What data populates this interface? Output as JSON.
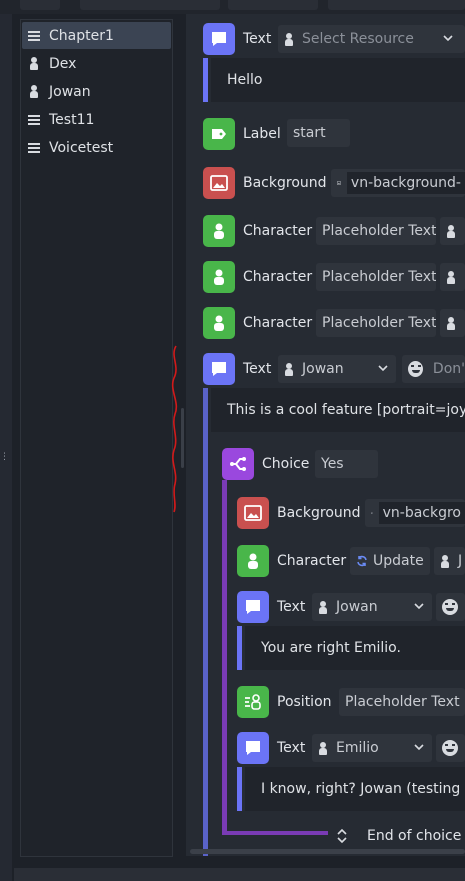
{
  "colors": {
    "text_event": "#6b74f6",
    "label_event": "#49b64a",
    "background_event": "#c9504f",
    "character_event": "#49b64a",
    "choice_event": "#9a48de",
    "selection": "#3b4453"
  },
  "tree": {
    "items": [
      {
        "label": "Chapter1",
        "icon": "list-icon"
      },
      {
        "label": "Dex",
        "icon": "person-icon"
      },
      {
        "label": "Jowan",
        "icon": "person-icon"
      },
      {
        "label": "Test11",
        "icon": "list-icon"
      },
      {
        "label": "Voicetest",
        "icon": "list-icon"
      }
    ]
  },
  "events": {
    "text1": {
      "title": "Text",
      "resource": "Select Resource",
      "text": "Hello"
    },
    "label1": {
      "title": "Label",
      "value": "start"
    },
    "bg1": {
      "title": "Background",
      "value": "vn-background-"
    },
    "char1": {
      "title": "Character",
      "value": "Placeholder Text"
    },
    "char2": {
      "title": "Character",
      "value": "Placeholder Text"
    },
    "char3": {
      "title": "Character",
      "value": "Placeholder Text"
    },
    "text2": {
      "title": "Text",
      "character": "Jowan",
      "portrait": "Don'",
      "text": "This is a cool feature [portrait=joy]."
    },
    "choice": {
      "title": "Choice",
      "value": "Yes",
      "end_label": "End of choice (Y"
    },
    "bg2": {
      "title": "Background",
      "value": "vn-backgro"
    },
    "char4": {
      "title": "Character",
      "action": "Update",
      "value": "J"
    },
    "text3": {
      "title": "Text",
      "character": "Jowan",
      "text": "You are right Emilio."
    },
    "position": {
      "title": "Position",
      "value": "Placeholder Text"
    },
    "text4": {
      "title": "Text",
      "character": "Emilio",
      "text": "I know, right? Jowan (testing co"
    }
  }
}
